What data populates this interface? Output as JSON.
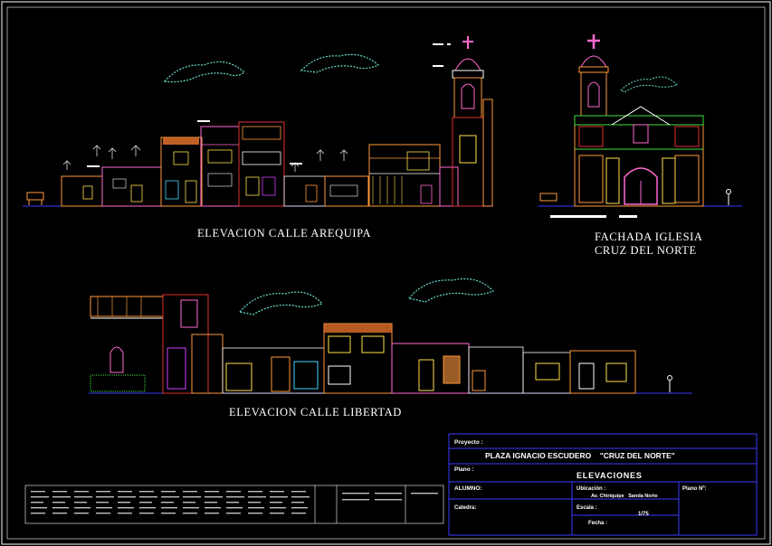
{
  "drawing_titles": {
    "arequipa": "ELEVACION CALLE AREQUIPA",
    "church_line1": "FACHADA IGLESIA",
    "church_line2": "CRUZ DEL NORTE",
    "libertad": "ELEVACION CALLE LIBERTAD"
  },
  "title_block": {
    "proyecto_label": "Proyecto :",
    "proyecto_value": "PLAZA IGNACIO ESCUDERO    \"CRUZ DEL NORTE\"",
    "plano_label": "Plano :",
    "plano_value": "ELEVACIONES",
    "alumno_label": "ALUMNO:",
    "ubicacion_label": "Ubicación :",
    "ubicacion_value": "Av. Chiriquipe   Sanda Norte",
    "escala_label": "Escala :",
    "escala_value": "1/75",
    "fecha_label": "Fecha :",
    "plano_no_label": "Plano Nº:",
    "catedra_label": "Catedra:"
  },
  "colors": {
    "background": "#000000",
    "frame": "#ffffff",
    "title_block_border": "#3a3aff",
    "trees": "#66e0d0",
    "ground": "#3a3aff",
    "building_orange": "#ff9a3c",
    "building_red": "#e23030",
    "building_pink": "#ff6ad0",
    "building_yellow": "#ffe04a",
    "building_white": "#ffffff",
    "building_magenta": "#d040ff",
    "building_green": "#40e040",
    "building_cyan": "#40d8ff"
  }
}
